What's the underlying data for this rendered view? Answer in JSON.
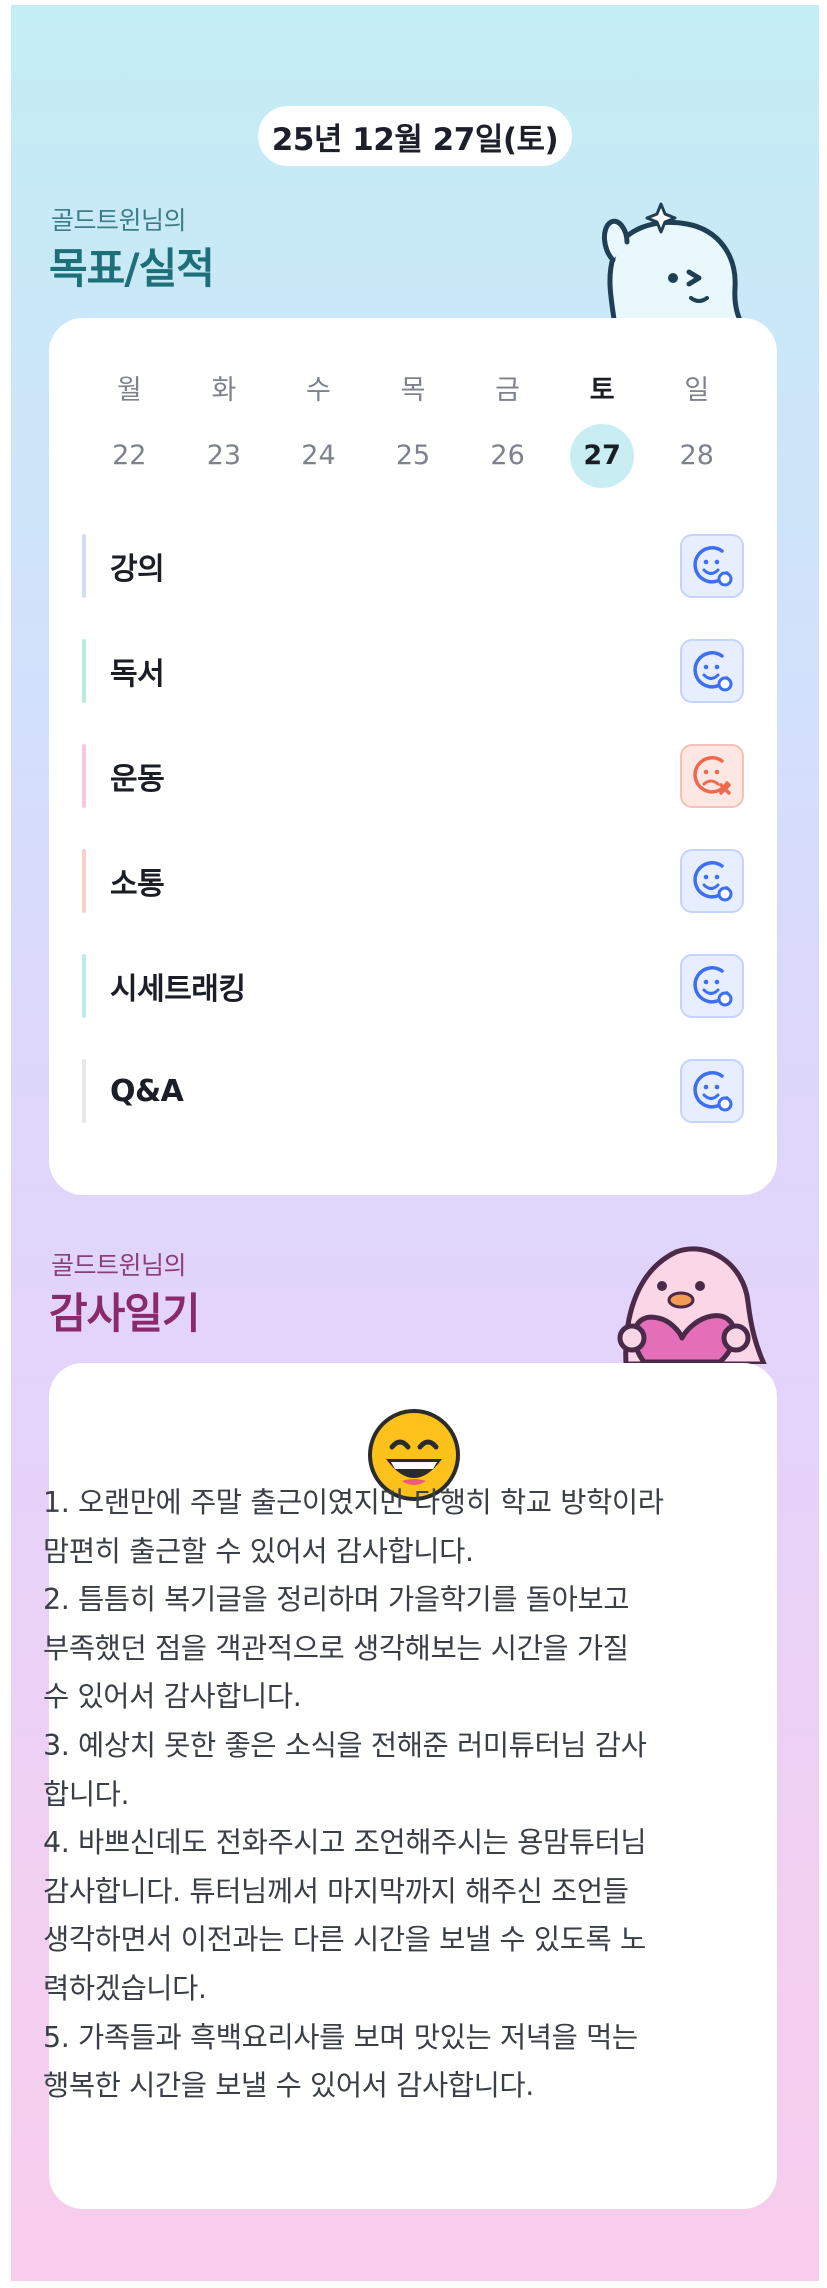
{
  "date": "25년 12월 27일(토)",
  "goals_section": {
    "owner": "골드트윈님의",
    "title": "목표/실적"
  },
  "week": [
    {
      "day": "월",
      "date": "22",
      "today": false
    },
    {
      "day": "화",
      "date": "23",
      "today": false
    },
    {
      "day": "수",
      "date": "24",
      "today": false
    },
    {
      "day": "목",
      "date": "25",
      "today": false
    },
    {
      "day": "금",
      "date": "26",
      "today": false
    },
    {
      "day": "토",
      "date": "27",
      "today": true
    },
    {
      "day": "일",
      "date": "28",
      "today": false
    }
  ],
  "goals": [
    {
      "label": "강의",
      "status": "done",
      "bar_color": "#d3dcf6",
      "icon": "smile-check-icon"
    },
    {
      "label": "독서",
      "status": "done",
      "bar_color": "#b9ecdf",
      "icon": "smile-check-icon"
    },
    {
      "label": "운동",
      "status": "missed",
      "bar_color": "#f7c7ea",
      "icon": "sad-x-icon"
    },
    {
      "label": "소통",
      "status": "done",
      "bar_color": "#f8d2c7",
      "icon": "smile-check-icon"
    },
    {
      "label": "시세트래킹",
      "status": "done",
      "bar_color": "#b9eaf0",
      "icon": "smile-check-icon"
    },
    {
      "label": "Q&A",
      "status": "done",
      "bar_color": "#e8e8ec",
      "icon": "smile-check-icon"
    }
  ],
  "gratitude_section": {
    "owner": "골드트윈님의",
    "title": "감사일기"
  },
  "mood_icon": "grinning-face-icon",
  "diary_lines": [
    "1. 오랜만에 주말 출근이였지만 다행히 학교 방학이라",
    "맘편히 출근할 수 있어서 감사합니다.",
    "2. 틈틈히 복기글을 정리하며 가을학기를 돌아보고",
    "부족했던 점을 객관적으로 생각해보는 시간을 가질",
    "수 있어서 감사합니다.",
    "3. 예상치 못한 좋은 소식을 전해준 러미튜터님 감사",
    "합니다.",
    "4. 바쁘신데도 전화주시고 조언해주시는 용맘튜터님",
    "감사합니다. 튜터님께서 마지막까지 해주신 조언들",
    "생각하면서 이전과는 다른 시간을 보낼 수 있도록 노",
    "력하겠습니다.",
    "5. 가족들과 흑백요리사를 보며 맛있는 저녁을 먹는",
    "행복한 시간을 보낼 수 있어서 감사합니다."
  ],
  "colors": {
    "goals_title": "#1d6f78",
    "gratitude_title": "#8a2a6e",
    "done": "#3d6ff5",
    "missed": "#ee6a4f"
  }
}
